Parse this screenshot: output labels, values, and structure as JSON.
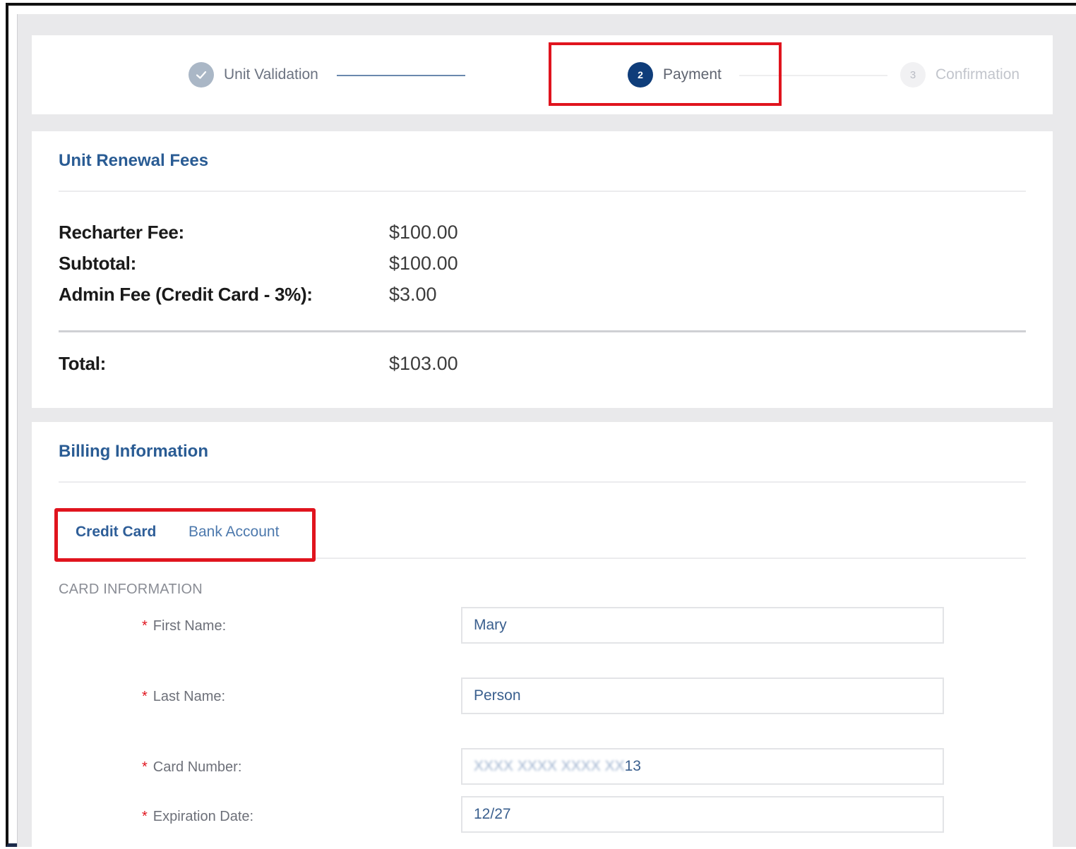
{
  "stepper": {
    "steps": [
      {
        "number": "✓",
        "label": "Unit Validation",
        "state": "complete"
      },
      {
        "number": "2",
        "label": "Payment",
        "state": "active"
      },
      {
        "number": "3",
        "label": "Confirmation",
        "state": "pending"
      }
    ]
  },
  "fees": {
    "title": "Unit Renewal Fees",
    "rows": [
      {
        "label": "Recharter Fee:",
        "value": "$100.00"
      },
      {
        "label": "Subtotal:",
        "value": "$100.00"
      },
      {
        "label": "Admin Fee (Credit Card - 3%):",
        "value": "$3.00"
      }
    ],
    "total": {
      "label": "Total:",
      "value": "$103.00"
    }
  },
  "billing": {
    "title": "Billing Information",
    "tabs": [
      {
        "label": "Credit Card",
        "active": true
      },
      {
        "label": "Bank Account",
        "active": false
      }
    ],
    "section_label": "CARD INFORMATION",
    "required_marker": "*",
    "fields": [
      {
        "label": "First Name:",
        "value": "Mary"
      },
      {
        "label": "Last Name:",
        "value": "Person"
      },
      {
        "label": "Card Number:",
        "value_hidden": "XXXX XXXX XXXX XX",
        "value_suffix": "13"
      },
      {
        "label": "Expiration Date:",
        "value": "12/27"
      }
    ]
  },
  "colors": {
    "accent": "#2a5c94",
    "active_step": "#0f3d7a",
    "highlight": "#e0141e",
    "required": "#e0141e"
  }
}
